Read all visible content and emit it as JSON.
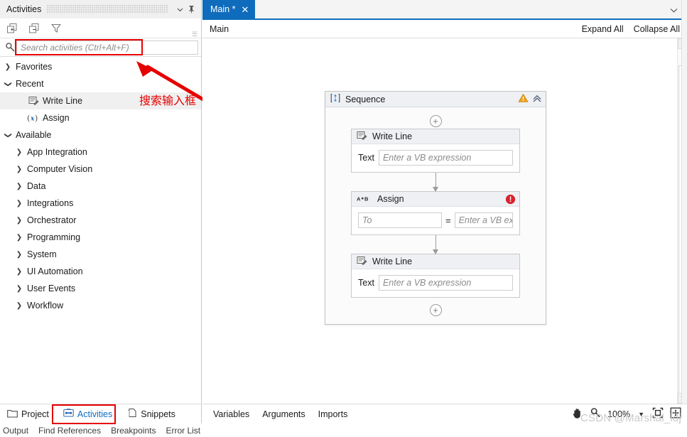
{
  "activities_panel": {
    "title": "Activities",
    "header_icons": [
      "chevron-down-icon",
      "pin-icon"
    ],
    "toolbar": [
      {
        "name": "expand-all-icon",
        "label": "Expand All"
      },
      {
        "name": "collapse-all-icon",
        "label": "Collapse All"
      },
      {
        "name": "filter-icon",
        "label": "Filter"
      }
    ],
    "search": {
      "value": "",
      "placeholder": "Search activities (Ctrl+Alt+F)"
    },
    "tree": [
      {
        "label": "Favorites",
        "state": "collapsed",
        "level": 1,
        "type": "group"
      },
      {
        "label": "Recent",
        "state": "expanded",
        "level": 1,
        "type": "group"
      },
      {
        "label": "Write Line",
        "level": 2,
        "type": "activity",
        "icon": "write-line-icon",
        "selected": true
      },
      {
        "label": "Assign",
        "level": 2,
        "type": "activity",
        "icon": "assign-icon",
        "selected": false
      },
      {
        "label": "Available",
        "state": "expanded",
        "level": 1,
        "type": "group"
      },
      {
        "label": "App Integration",
        "state": "collapsed",
        "level": 2,
        "type": "group"
      },
      {
        "label": "Computer Vision",
        "state": "collapsed",
        "level": 2,
        "type": "group"
      },
      {
        "label": "Data",
        "state": "collapsed",
        "level": 2,
        "type": "group"
      },
      {
        "label": "Integrations",
        "state": "collapsed",
        "level": 2,
        "type": "group"
      },
      {
        "label": "Orchestrator",
        "state": "collapsed",
        "level": 2,
        "type": "group"
      },
      {
        "label": "Programming",
        "state": "collapsed",
        "level": 2,
        "type": "group"
      },
      {
        "label": "System",
        "state": "collapsed",
        "level": 2,
        "type": "group"
      },
      {
        "label": "UI Automation",
        "state": "collapsed",
        "level": 2,
        "type": "group"
      },
      {
        "label": "User Events",
        "state": "collapsed",
        "level": 2,
        "type": "group"
      },
      {
        "label": "Workflow",
        "state": "collapsed",
        "level": 2,
        "type": "group"
      }
    ]
  },
  "annotation": {
    "text": "搜索输入框",
    "color": "#e60000"
  },
  "left_tabs": [
    {
      "label": "Project",
      "icon": "folder-icon",
      "active": false
    },
    {
      "label": "Activities",
      "icon": "activities-icon",
      "active": true
    },
    {
      "label": "Snippets",
      "icon": "snippets-icon",
      "active": false
    }
  ],
  "bottom_bar": [
    {
      "label": "Output"
    },
    {
      "label": "Find References"
    },
    {
      "label": "Breakpoints"
    },
    {
      "label": "Error List"
    }
  ],
  "designer": {
    "tab": {
      "label": "Main *",
      "close": "✕"
    },
    "tabstrip_overflow_icon": "chevron-down-icon",
    "breadcrumb": "Main",
    "expand_all": "Expand All",
    "collapse_all": "Collapse All",
    "sequence": {
      "title": "Sequence",
      "icon": "sequence-icon",
      "warning_icon": "warning-triangle-icon",
      "collapse_icon": "double-chevron-up-icon"
    },
    "activities": [
      {
        "name": "Write Line",
        "icon": "write-line-icon",
        "field_label": "Text",
        "field_placeholder": "Enter a VB expression",
        "field_value": "",
        "error": false
      },
      {
        "name": "Assign",
        "icon": "assign-ab-icon",
        "to_placeholder": "To",
        "to_value": "",
        "equals": "=",
        "expr_placeholder": "Enter a VB expre",
        "expr_value": "",
        "error": true,
        "error_icon": "error-circle-icon"
      },
      {
        "name": "Write Line",
        "icon": "write-line-icon",
        "field_label": "Text",
        "field_placeholder": "Enter a VB expression",
        "field_value": "",
        "error": false
      }
    ],
    "status": {
      "tabs": [
        {
          "label": "Variables"
        },
        {
          "label": "Arguments"
        },
        {
          "label": "Imports"
        }
      ],
      "pan_icon": "hand-pan-icon",
      "zoom_icon": "magnifier-icon",
      "zoom_level": "100%",
      "zoom_caret_icon": "caret-down-icon",
      "fit_icon": "fit-to-screen-icon",
      "overview_icon": "overview-icon"
    }
  },
  "watermark": "CSDN @Marshal_ldj",
  "colors": {
    "accent": "#0f6cbd",
    "annotation": "#e60000",
    "warning": "#eda21f",
    "error": "#d9232e",
    "panel_bg": "#f0f0f0",
    "activity_header": "#eef0f4"
  }
}
